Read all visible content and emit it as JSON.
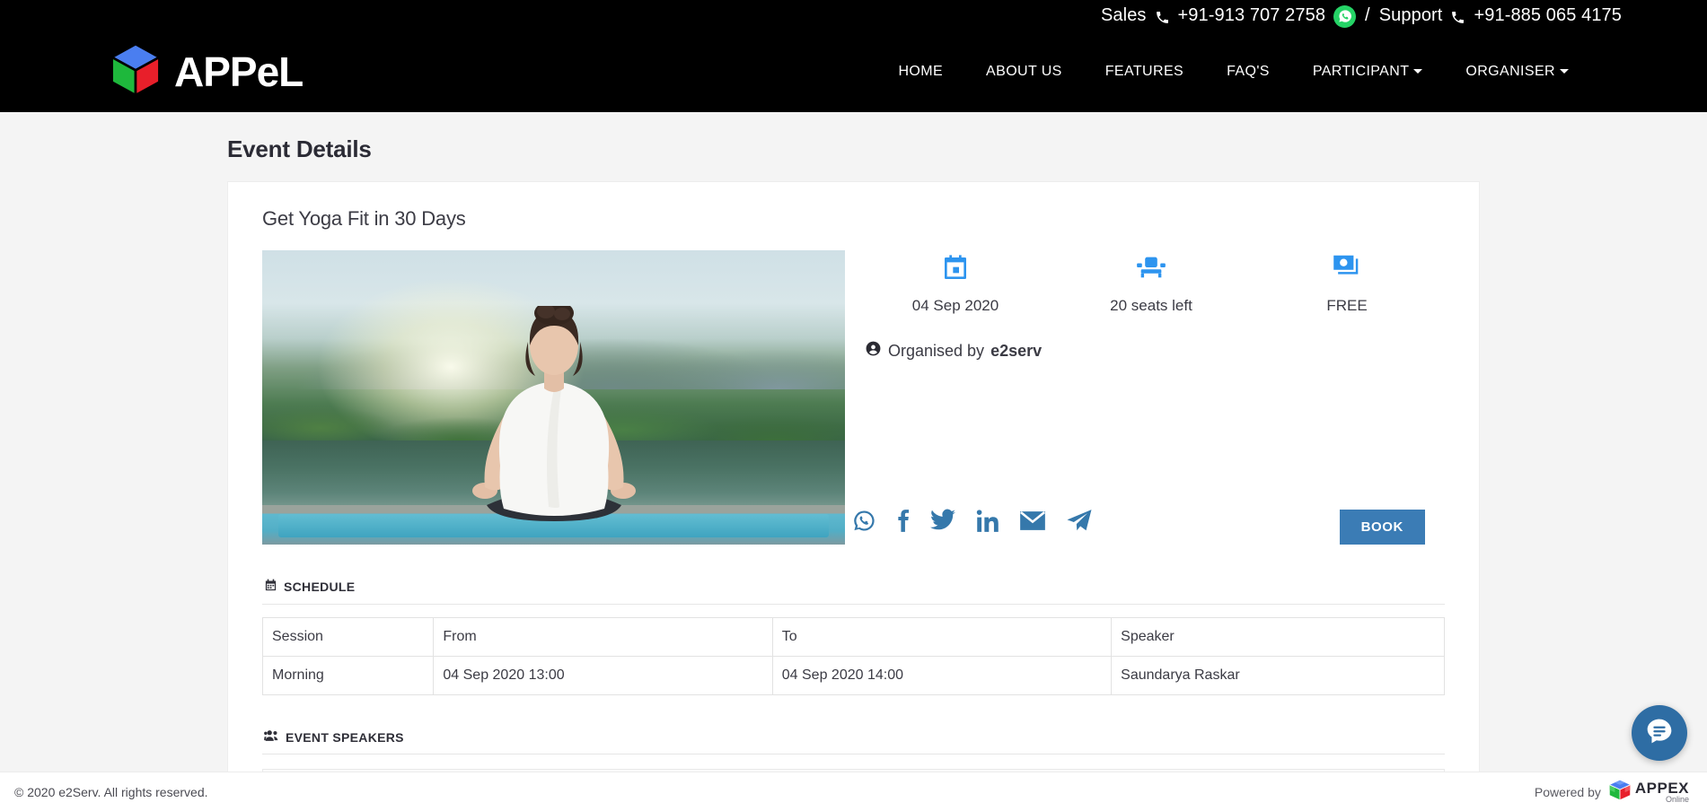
{
  "topbar": {
    "sales_label": "Sales",
    "sales_phone": "+91-913 707 2758",
    "separator": "/",
    "support_label": "Support",
    "support_phone": "+91-885 065 4175",
    "whatsapp_icon": "whatsapp-icon",
    "phone_icon": "phone-icon"
  },
  "brand": {
    "name": "APPeL",
    "logo_icon": "cube-logo-icon",
    "cube_top_color": "#4a7ef0",
    "cube_left_color": "#1eb83c",
    "cube_right_color": "#e81f2a"
  },
  "nav": {
    "items": [
      {
        "label": "HOME",
        "has_caret": false
      },
      {
        "label": "ABOUT US",
        "has_caret": false
      },
      {
        "label": "FEATURES",
        "has_caret": false
      },
      {
        "label": "FAQ'S",
        "has_caret": false
      },
      {
        "label": "PARTICIPANT",
        "has_caret": true
      },
      {
        "label": "ORGANISER",
        "has_caret": true
      }
    ]
  },
  "page": {
    "title": "Event Details"
  },
  "event": {
    "title": "Get Yoga Fit in 30 Days",
    "image_alt": "woman meditating in lotus pose by a lake",
    "info": [
      {
        "icon": "calendar-icon",
        "text": "04 Sep 2020"
      },
      {
        "icon": "seat-icon",
        "text": "20 seats left"
      },
      {
        "icon": "money-icon",
        "text": "FREE"
      }
    ],
    "organised_prefix": "Organised by",
    "organiser_name": "e2serv",
    "organiser_icon": "user-circle-icon",
    "book_label": "BOOK",
    "accent_color": "#3b7cb5",
    "icon_color": "#2d94ef"
  },
  "share": {
    "items": [
      {
        "icon": "whatsapp-share-icon",
        "label": "WhatsApp"
      },
      {
        "icon": "facebook-share-icon",
        "label": "Facebook"
      },
      {
        "icon": "twitter-share-icon",
        "label": "Twitter"
      },
      {
        "icon": "linkedin-share-icon",
        "label": "LinkedIn"
      },
      {
        "icon": "email-share-icon",
        "label": "Email"
      },
      {
        "icon": "telegram-share-icon",
        "label": "Telegram"
      }
    ],
    "color": "#3578ab"
  },
  "schedule": {
    "heading": "SCHEDULE",
    "heading_icon": "calendar-alt-icon",
    "columns": [
      "Session",
      "From",
      "To",
      "Speaker"
    ],
    "rows": [
      [
        "Morning",
        "04 Sep 2020 13:00",
        "04 Sep 2020 14:00",
        "Saundarya Raskar"
      ]
    ]
  },
  "speakers": {
    "heading": "EVENT SPEAKERS",
    "heading_icon": "users-icon"
  },
  "footer": {
    "copyright": "© 2020 e2Serv. All rights reserved.",
    "powered_by": "Powered by",
    "apex_name": "APPEX",
    "apex_sub": "Online",
    "apex_icon": "rubiks-cube-icon"
  },
  "chat": {
    "icon": "chat-bubble-icon",
    "color": "#2e6da4"
  }
}
